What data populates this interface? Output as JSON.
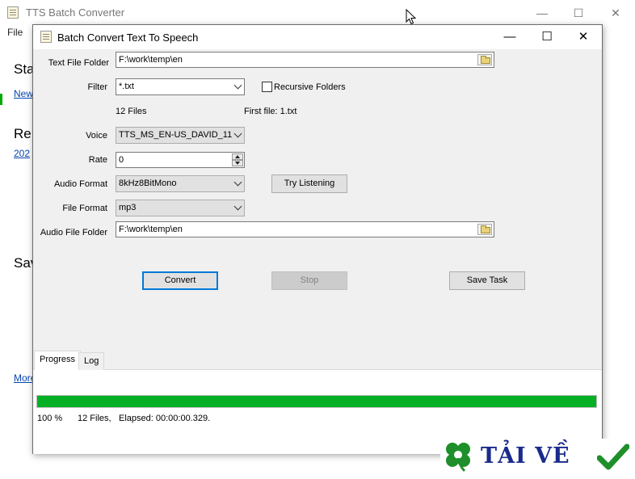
{
  "background_app": {
    "title": "TTS Batch Converter",
    "window_controls": [
      "—",
      "☐",
      "✕"
    ],
    "menu": [
      "File"
    ],
    "partial_texts": [
      "Sta",
      "New",
      "Re",
      "202",
      "Sav",
      "More"
    ]
  },
  "dialog": {
    "title": "Batch Convert Text To Speech",
    "controls": {
      "minimize": "—",
      "maximize": "☐",
      "close": "✕"
    },
    "text_file_folder": {
      "label": "Text File Folder",
      "value": "F:\\work\\temp\\en"
    },
    "filter": {
      "label": "Filter",
      "value": "*.txt"
    },
    "recursive": {
      "label": "Recursive Folders",
      "checked": false
    },
    "file_count": "12 Files",
    "first_file": "First file: 1.txt",
    "voice": {
      "label": "Voice",
      "value": "TTS_MS_EN-US_DAVID_11"
    },
    "rate": {
      "label": "Rate",
      "value": "0"
    },
    "audio_format": {
      "label": "Audio Format",
      "value": "8kHz8BitMono"
    },
    "try_listening": "Try Listening",
    "file_format": {
      "label": "File Format",
      "value": "mp3"
    },
    "audio_file_folder": {
      "label": "Audio File Folder",
      "value": "F:\\work\\temp\\en"
    },
    "buttons": {
      "convert": "Convert",
      "stop": "Stop",
      "save_task": "Save Task"
    },
    "tabs": [
      "Progress",
      "Log"
    ],
    "progress": {
      "fraction": 1.0,
      "percent_text": "100 %",
      "files_text": "12 Files,",
      "elapsed_text": "Elapsed: 00:00:00.329."
    }
  },
  "watermark": {
    "text": "TẢI VỀ",
    "icon": "four-leaf-clover-icon",
    "check_icon": "check-mark-icon"
  },
  "colors": {
    "progress": "#06b025",
    "default_button_border": "#0078d7",
    "link": "#0645ad",
    "watermark": "#1a2b8c"
  }
}
